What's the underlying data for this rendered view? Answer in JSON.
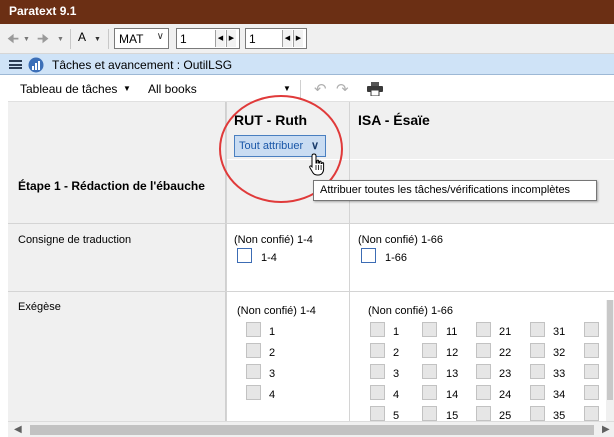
{
  "window": {
    "title": "Paratext 9.1"
  },
  "toolbar": {
    "font_button": "A",
    "project_combo": "MAT",
    "chapter_value": "1",
    "verse_value": "1"
  },
  "tab": {
    "title": "Tâches et avancement : OutilLSG"
  },
  "subtoolbar": {
    "view_menu": "Tableau de tâches",
    "books_menu": "All books"
  },
  "grid": {
    "books": [
      {
        "title": "RUT - Ruth",
        "assign_button": "Tout attribuer"
      },
      {
        "title": "ISA - Ésaïe"
      }
    ],
    "stage": "Étape 1 - Rédaction de l'ébauche",
    "rows": [
      {
        "label": "Consigne de traduction",
        "cells": [
          {
            "status": "(Non confié) 1-4",
            "items": [
              "1-4"
            ]
          },
          {
            "status": "(Non confié) 1-66",
            "items": [
              "1-66"
            ]
          }
        ]
      },
      {
        "label": "Exégèse",
        "cells": [
          {
            "status": "(Non confié) 1-4",
            "items": [
              "1",
              "2",
              "3",
              "4"
            ]
          },
          {
            "status": "(Non confié) 1-66",
            "items": [
              "1",
              "2",
              "3",
              "4",
              "5",
              "11",
              "12",
              "13",
              "14",
              "15",
              "21",
              "22",
              "23",
              "24",
              "25",
              "31",
              "32",
              "33",
              "34",
              "35"
            ]
          }
        ]
      }
    ]
  },
  "tooltip": {
    "text": "Attribuer toutes les tâches/vérifications incomplètes"
  },
  "colors": {
    "titlebar": "#6b2f14",
    "tab_header": "#cfe3f7",
    "assign_button": "#c9dcf2",
    "checkbox_border": "#3c6cb4",
    "highlight_circle": "#e03a3a"
  },
  "icons": [
    "back-arrow-icon",
    "forward-arrow-icon",
    "hamburger-menu-icon",
    "tasks-chart-icon",
    "undo-icon",
    "redo-icon",
    "print-icon",
    "chevron-down-icon",
    "hand-cursor-icon"
  ]
}
